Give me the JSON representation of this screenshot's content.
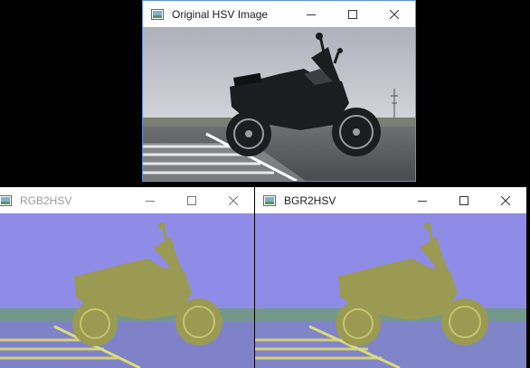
{
  "windows": [
    {
      "id": "original",
      "title": "Original HSV Image",
      "active": true,
      "filter": "none",
      "controls": [
        "minimize-icon",
        "maximize-icon",
        "close-icon"
      ]
    },
    {
      "id": "rgb2hsv",
      "title": "RGB2HSV",
      "active": false,
      "filter": "hsv-rgb",
      "controls": [
        "minimize-icon",
        "maximize-icon",
        "close-icon"
      ]
    },
    {
      "id": "bgr2hsv",
      "title": "BGR2HSV",
      "active": false,
      "filter": "hsv-bgr",
      "controls": [
        "minimize-icon",
        "maximize-icon",
        "close-icon"
      ]
    }
  ],
  "colors": {
    "desktop": "#000000",
    "titlebar": "#ffffff",
    "title_active": "#1a1a1a",
    "title_inactive": "#9a9a9a",
    "original_sky": "#b9bbc4",
    "hsv_sky": "#8f8ce8",
    "hsv_ground": "#9a9a52"
  }
}
